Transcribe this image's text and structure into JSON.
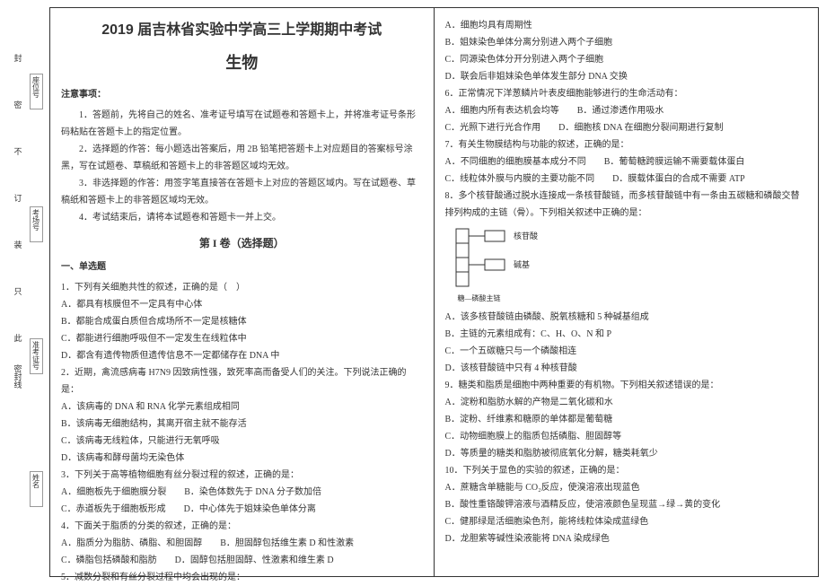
{
  "strip": {
    "markers": [
      "此",
      "只",
      "装",
      "订",
      "不",
      "密",
      "封"
    ],
    "lineword": "密封线",
    "labels": {
      "name": "姓名",
      "exam_no": "准考证号",
      "room": "考场号",
      "seat": "座位号"
    }
  },
  "header": {
    "exam_title": "2019 届吉林省实验中学高三上学期期中考试",
    "subject": "生物"
  },
  "notice": {
    "heading": "注意事项：",
    "items": [
      "1．答题前，先将自己的姓名、准考证号填写在试题卷和答题卡上，并将准考证号条形码粘贴在答题卡上的指定位置。",
      "2．选择题的作答：每小题选出答案后，用 2B 铅笔把答题卡上对应题目的答案标号涂黑，写在试题卷、草稿纸和答题卡上的非答题区域均无效。",
      "3．非选择题的作答：用签字笔直接答在答题卡上对应的答题区域内。写在试题卷、草稿纸和答题卡上的非答题区域均无效。",
      "4．考试结束后，请将本试题卷和答题卡一并上交。"
    ]
  },
  "section1": {
    "title": "第 I 卷（选择题）",
    "sub": "一、单选题"
  },
  "q1": {
    "stem": "1．下列有关细胞共性的叙述，正确的是（　）",
    "A": "A．都具有核膜但不一定具有中心体",
    "B": "B．都能合成蛋白质但合成场所不一定是核糖体",
    "C": "C．都能进行细胞呼吸但不一定发生在线粒体中",
    "D": "D．都含有遗传物质但遗传信息不一定都储存在 DNA 中"
  },
  "q2": {
    "stem": "2．近期，禽流感病毒 H7N9 因致病性强，致死率高而备受人们的关注。下列说法正确的是：",
    "A": "A．该病毒的 DNA 和 RNA 化学元素组成相同",
    "B": "B．该病毒无细胞结构，其离开宿主就不能存活",
    "C": "C．该病毒无线粒体，只能进行无氧呼吸",
    "D": "D．该病毒和酵母菌均无染色体"
  },
  "q3": {
    "stem": "3．下列关于高等植物细胞有丝分裂过程的叙述，正确的是：",
    "A": "A．细胞板先于细胞膜分裂　　B．染色体数先于 DNA 分子数加倍",
    "C": "C．赤道板先于细胞板形成　　D．中心体先于姐妹染色单体分离"
  },
  "q4": {
    "stem": "4．下面关于脂质的分类的叙述，正确的是：",
    "A": "A．脂质分为脂肪、磷脂、和胆固醇　　B．胆固醇包括维生素 D 和性激素",
    "C": "C．磷脂包括磷酸和脂肪　　D．固醇包括胆固醇、性激素和维生素 D"
  },
  "q5": {
    "stem": "5．减数分裂和有丝分裂过程中均会出现的是：",
    "A": "A．细胞均具有周期性",
    "B": "B．姐妹染色单体分离分别进入两个子细胞",
    "C": "C．同源染色体分开分别进入两个子细胞",
    "D": "D．联会后非姐妹染色单体发生部分 DNA 交换"
  },
  "q6": {
    "stem": "6．正常情况下洋葱鳞片叶表皮细胞能够进行的生命活动有：",
    "A": "A．细胞内所有表达机会均等　　B．通过渗透作用吸水",
    "C": "C．光照下进行光合作用　　D．细胞核 DNA 在细胞分裂间期进行复制"
  },
  "q7": {
    "stem": "7．有关生物膜结构与功能的叙述，正确的是：",
    "A": "A．不同细胞的细胞膜基本成分不同　　B．葡萄糖跨膜运输不需要载体蛋白",
    "C": "C．线粒体外膜与内膜的主要功能不同　　D．膜载体蛋白的合成不需要 ATP"
  },
  "q8": {
    "stem": "8．多个核苷酸通过脱水连接成一条核苷酸链，而多核苷酸链中有一条由五碳糖和磷酸交替排列构成的主链（骨）。下列相关叙述中正确的是：",
    "diagram_labels": {
      "top": "核苷酸",
      "middle": "碱基",
      "bottom": "糖—磷酸主链"
    },
    "A": "A．该多核苷酸链由磷酸、脱氧核糖和 5 种碱基组成",
    "B": "B．主链的元素组成有：C、H、O、N 和 P",
    "C": "C．一个五碳糖只与一个磷酸相连",
    "D": "D．该核苷酸链中只有 4 种核苷酸"
  },
  "q9": {
    "stem": "9．糖类和脂质是细胞中两种重要的有机物。下列相关叙述错误的是：",
    "A": "A．淀粉和脂肪水解的产物是二氧化碳和水",
    "B": "B．淀粉、纤维素和糖原的单体都是葡萄糖",
    "C": "C．动物细胞膜上的脂质包括磷脂、胆固醇等",
    "D": "D．等质量的糖类和脂肪被彻底氧化分解，糖类耗氧少"
  },
  "q10": {
    "stem": "10．下列关于显色的实验的叙述，正确的是：",
    "A": "A．蔗糖含单糖能与 CO₂反应，使溴溶液出现蓝色",
    "B": "B．酸性重铬酸钾溶液与酒精反应，使溶液颜色呈现蓝→绿→黄的变化",
    "C": "C．健那绿是活细胞染色剂，能将线粒体染成蓝绿色",
    "D": "D．龙胆紫等碱性染液能将 DNA 染成绿色"
  }
}
